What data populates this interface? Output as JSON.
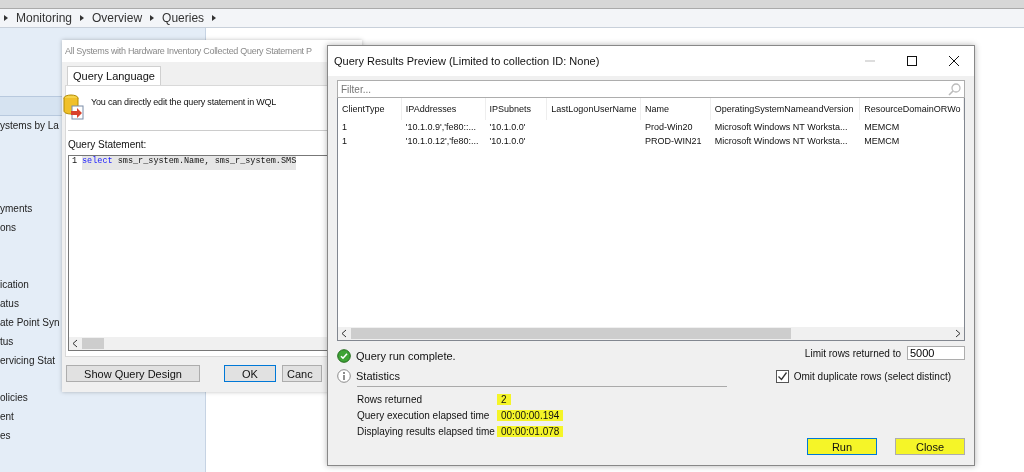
{
  "breadcrumb": [
    "Monitoring",
    "Overview",
    "Queries"
  ],
  "sidebar": {
    "items": [
      "ystems by La",
      "yments",
      "ons",
      "ication",
      "atus",
      "ate Point Syn",
      "tus",
      "ervicing Stat",
      "olicies",
      "ent",
      "es"
    ]
  },
  "statement_dialog": {
    "title": "All Systems with Hardware Inventory Collected Query Statement P",
    "tabs": [
      {
        "label": "Query Language",
        "selected": true
      }
    ],
    "info": "You can directly edit the query statement in WQL",
    "statement_label": "Query Statement:",
    "editor": {
      "line_number": "1",
      "keyword": "select",
      "code": " sms_r_system.Name, sms_r_system.SMS"
    },
    "buttons": [
      {
        "label": "Show Query Design",
        "kind": "wide"
      },
      {
        "label": "OK",
        "kind": "default"
      },
      {
        "label": "Canc",
        "kind": "cut"
      }
    ]
  },
  "results_dialog": {
    "title": "Query Results Preview (Limited to collection ID: None)",
    "filter": {
      "placeholder": "Filter..."
    },
    "table": {
      "columns": [
        "ClientType",
        "IPAddresses",
        "IPSubnets",
        "LastLogonUserName",
        "Name",
        "OperatingSystemNameandVersion",
        "ResourceDomainORWo"
      ],
      "rows": [
        [
          "1",
          "'10.1.0.9','fe80::...",
          "'10.1.0.0'",
          "",
          "Prod-Win20",
          "Microsoft Windows NT Worksta...",
          "MEMCM"
        ],
        [
          "1",
          "'10.1.0.12','fe80:...",
          "'10.1.0.0'",
          "",
          "PROD-WIN21",
          "Microsoft Windows NT Worksta...",
          "MEMCM"
        ]
      ]
    },
    "status": "Query run complete.",
    "limit": {
      "label": "Limit rows returned to",
      "value": "5000"
    },
    "statistics_label": "Statistics",
    "omit_duplicates": {
      "label": "Omit duplicate rows (select distinct)",
      "checked": true
    },
    "statistics": [
      {
        "label": "Rows returned",
        "value": "2",
        "highlighted": true
      },
      {
        "label": "Query execution elapsed time",
        "value": "00:00:00.194",
        "highlighted": true
      },
      {
        "label": "Displaying results elapsed time",
        "value": "00:00:01.078",
        "highlighted": true
      }
    ],
    "buttons": [
      {
        "label": "Run",
        "kind": "default",
        "highlighted": true
      },
      {
        "label": "Close",
        "kind": "normal",
        "highlighted": true
      }
    ]
  }
}
